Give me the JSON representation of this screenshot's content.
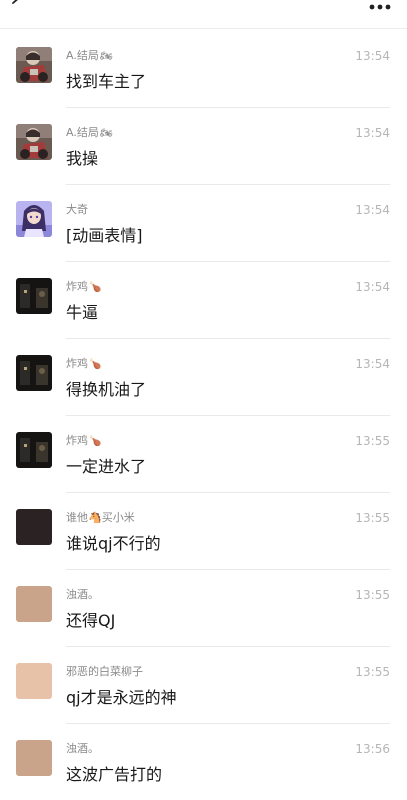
{
  "header": {
    "back_icon": "chevron-left-icon",
    "more_icon": "more-dots-icon"
  },
  "messages": [
    {
      "sender": "A.结局",
      "sender_emoji": "🏍",
      "time": "13:54",
      "text": "找到车主了",
      "avatar": "avatar-moto-rider"
    },
    {
      "sender": "A.结局",
      "sender_emoji": "🏍",
      "time": "13:54",
      "text": "我操",
      "avatar": "avatar-moto-rider"
    },
    {
      "sender": "大奇",
      "sender_emoji": "",
      "time": "13:54",
      "text": "[动画表情]",
      "avatar": "avatar-anime-girl"
    },
    {
      "sender": "炸鸡",
      "sender_emoji": "🍗",
      "time": "13:54",
      "text": "牛逼",
      "avatar": "avatar-dark-photo"
    },
    {
      "sender": "炸鸡",
      "sender_emoji": "🍗",
      "time": "13:54",
      "text": "得换机油了",
      "avatar": "avatar-dark-photo"
    },
    {
      "sender": "炸鸡",
      "sender_emoji": "🍗",
      "time": "13:55",
      "text": "一定进水了",
      "avatar": "avatar-dark-photo"
    },
    {
      "sender": "谁他🐴买小米",
      "sender_emoji": "",
      "time": "13:55",
      "text": "谁说qj不行的",
      "avatar": "avatar-dark-square"
    },
    {
      "sender": "浊酒。",
      "sender_emoji": "",
      "time": "13:55",
      "text": "还得QJ",
      "avatar": "avatar-tan-square"
    },
    {
      "sender": "邪恶的白菜柳子",
      "sender_emoji": "",
      "time": "13:55",
      "text": "qj才是永远的神",
      "avatar": "avatar-peach-square"
    },
    {
      "sender": "浊酒。",
      "sender_emoji": "",
      "time": "13:56",
      "text": "这波广告打的",
      "avatar": "avatar-tan-square"
    }
  ],
  "colors": {
    "background": "#ffffff",
    "sender_text": "#8a8a8a",
    "time_text": "#b6b6b6",
    "message_text": "#191919",
    "divider": "#e9e9e9",
    "avatar_dark_square": "#2b2224",
    "avatar_tan_square": "#c9a48a",
    "avatar_peach_square": "#e8c2a8"
  }
}
